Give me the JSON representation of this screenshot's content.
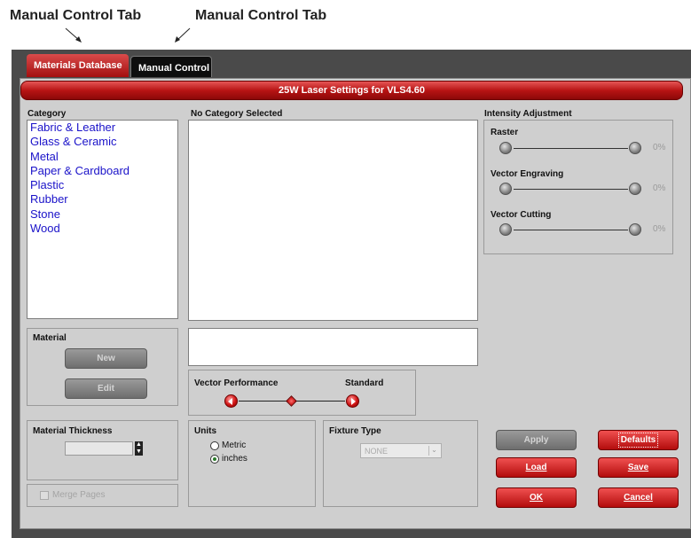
{
  "callouts": {
    "left": "Manual Control Tab",
    "right": "Manual Control Tab"
  },
  "tabs": [
    {
      "label": "Materials Database",
      "active": true
    },
    {
      "label": "Manual Control",
      "active": false
    }
  ],
  "title_bar": "25W Laser Settings for VLS4.60",
  "category": {
    "label": "Category",
    "items": [
      "Fabric & Leather",
      "Glass & Ceramic",
      "Metal",
      "Paper & Cardboard",
      "Plastic",
      "Rubber",
      "Stone",
      "Wood"
    ]
  },
  "subcategory": {
    "label": "No Category Selected"
  },
  "intensity": {
    "label": "Intensity Adjustment",
    "sliders": [
      {
        "label": "Raster",
        "value": "0%"
      },
      {
        "label": "Vector Engraving",
        "value": "0%"
      },
      {
        "label": "Vector Cutting",
        "value": "0%"
      }
    ]
  },
  "material": {
    "label": "Material",
    "new_button": "New",
    "edit_button": "Edit"
  },
  "vector_performance": {
    "label": "Vector Performance",
    "value": "Standard"
  },
  "thickness": {
    "label": "Material Thickness",
    "value": ""
  },
  "units": {
    "label": "Units",
    "options": [
      {
        "label": "Metric",
        "selected": false
      },
      {
        "label": "inches",
        "selected": true
      }
    ]
  },
  "fixture": {
    "label": "Fixture Type",
    "value": "NONE"
  },
  "merge_pages": {
    "label": "Merge Pages",
    "checked": false
  },
  "buttons": {
    "apply": "Apply",
    "defaults": "Defaults",
    "load": "Load",
    "save": "Save",
    "ok": "OK",
    "cancel": "Cancel"
  },
  "colors": {
    "accent_red": "#b81414",
    "link_blue": "#1a12c9",
    "window_dark": "#4a4a4a",
    "panel_gray": "#cfcfcf"
  }
}
